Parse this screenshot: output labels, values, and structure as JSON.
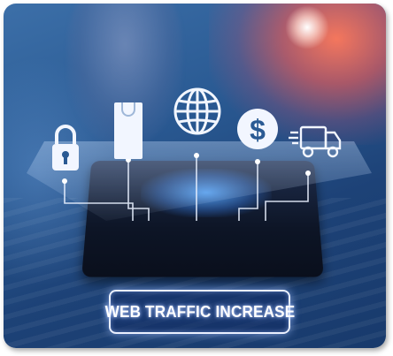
{
  "image": {
    "caption_text": "WEB TRAFFIC INCREASE",
    "icons": [
      "lock-icon",
      "shopping-bag-icon",
      "globe-icon",
      "dollar-coin-icon",
      "delivery-truck-icon"
    ],
    "colors": {
      "background": "#2a5a93",
      "accent_glow": "#ff7a5a",
      "icon_white": "#f2f6ff",
      "badge_border": "#eaf0ff"
    }
  }
}
